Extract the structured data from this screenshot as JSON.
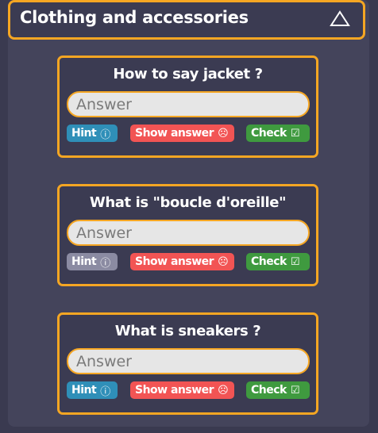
{
  "section": {
    "title": "Clothing and accessories",
    "collapse_icon": "triangle-up-icon"
  },
  "questions": [
    {
      "text": "How to say jacket ?",
      "input_placeholder": "Answer",
      "hint_label": "Hint",
      "hint_state": "active",
      "show_label": "Show answer",
      "check_label": "Check"
    },
    {
      "text": "What is \"boucle d'oreille\"",
      "input_placeholder": "Answer",
      "hint_label": "Hint",
      "hint_state": "disabled",
      "show_label": "Show answer",
      "check_label": "Check"
    },
    {
      "text": "What is sneakers ?",
      "input_placeholder": "Answer",
      "hint_label": "Hint",
      "hint_state": "active",
      "show_label": "Show answer",
      "check_label": "Check"
    }
  ],
  "icons": {
    "hint": "question-circle-icon",
    "show": "sad-face-icon",
    "check": "checkbox-check-icon"
  },
  "colors": {
    "accent": "#f5a623",
    "hint": "#2f8fb8",
    "hint_disabled": "#8b8ba2",
    "show_answer": "#f25454",
    "check": "#3f9a3f",
    "background": "#3a3a50"
  }
}
